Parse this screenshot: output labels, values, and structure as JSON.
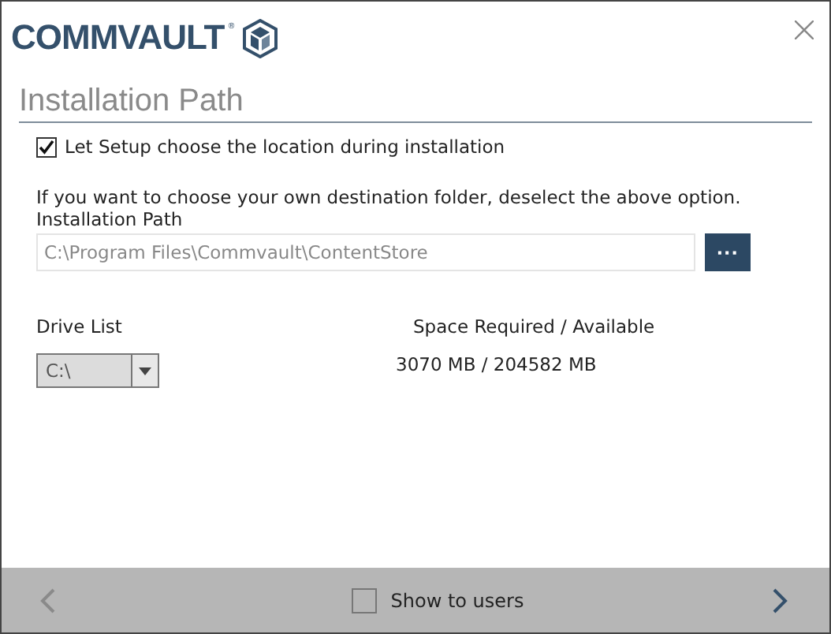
{
  "logo": {
    "text": "COMMVAULT",
    "mark": "®"
  },
  "page": {
    "title": "Installation Path"
  },
  "auto_location": {
    "label": "Let Setup choose the location during installation",
    "checked": true
  },
  "hint": "If you want to choose your own destination folder, deselect the above option.",
  "path": {
    "label": "Installation Path",
    "value": "C:\\Program Files\\Commvault\\ContentStore",
    "disabled": true,
    "browse": "···"
  },
  "drive": {
    "label": "Drive List",
    "value": "C:\\",
    "disabled": true
  },
  "space": {
    "label": "Space Required / Available",
    "value": "3070 MB / 204582 MB"
  },
  "footer": {
    "back_disabled": true,
    "next_disabled": false,
    "show_to_users": {
      "label": "Show to users",
      "checked": false
    }
  }
}
